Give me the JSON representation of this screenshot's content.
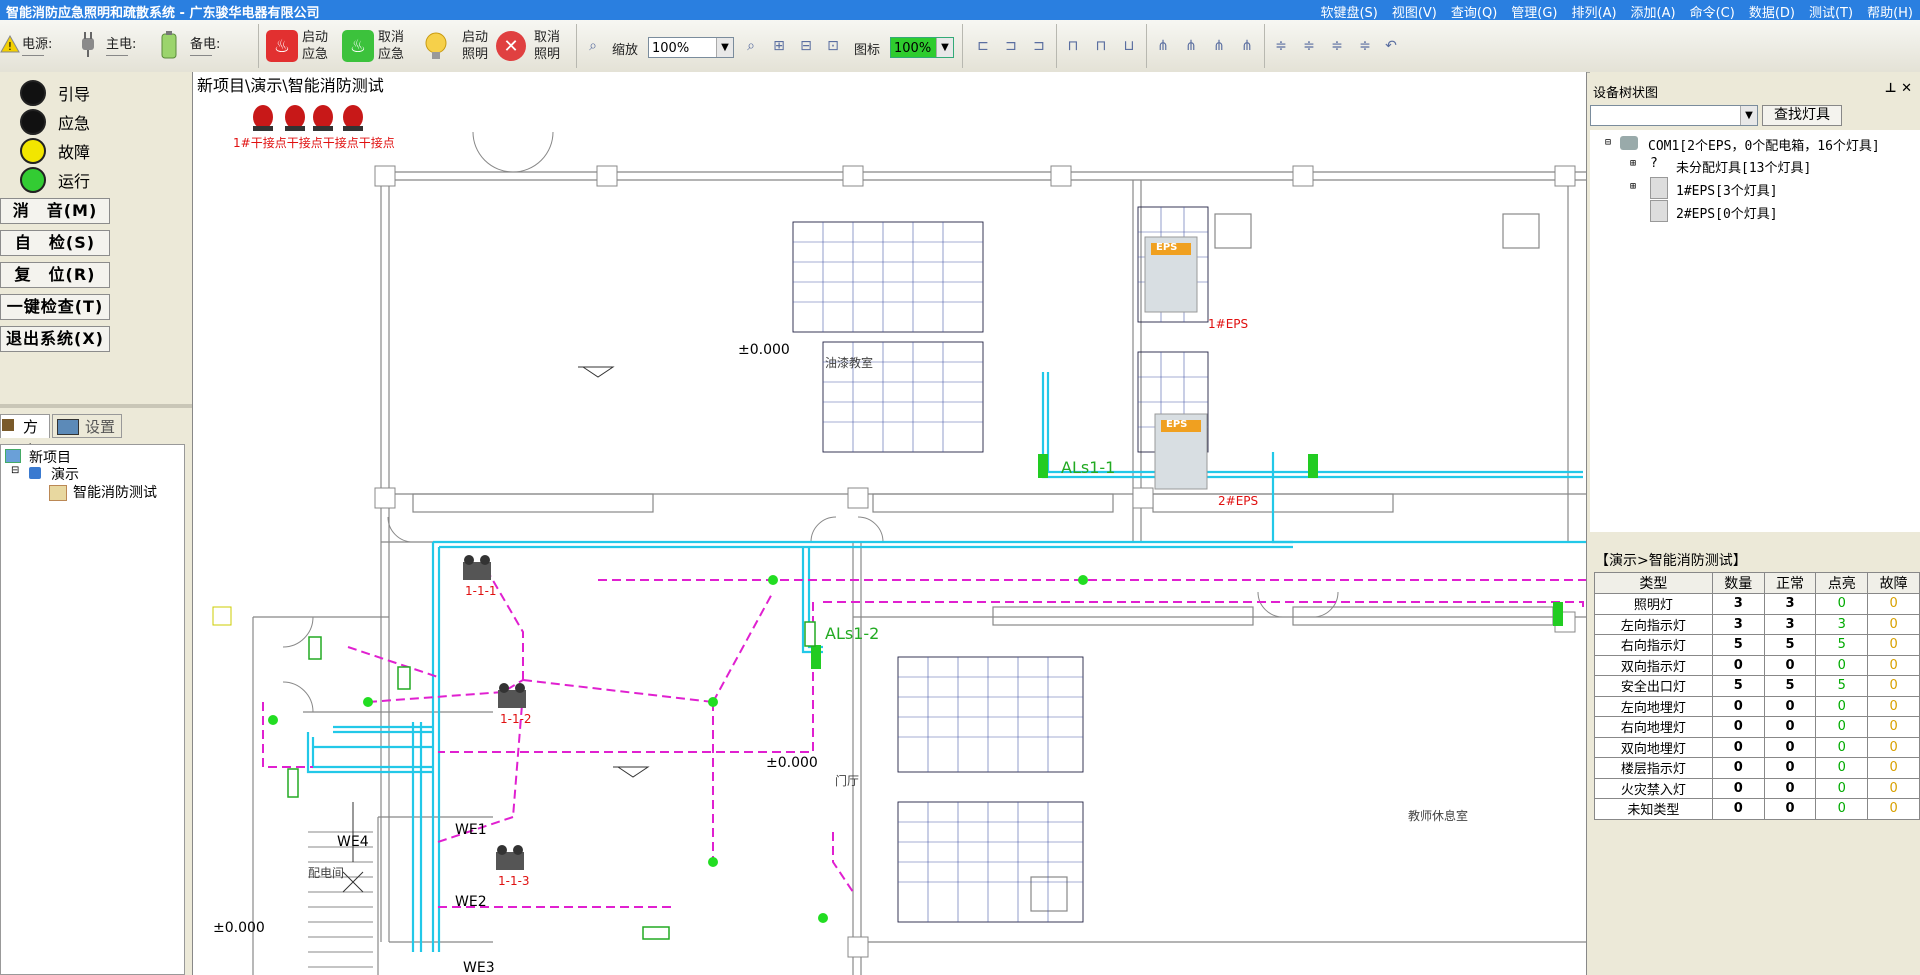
{
  "window": {
    "title": "智能消防应急照明和疏散系统 - 广东骏华电器有限公司"
  },
  "menu": [
    "软键盘(S)",
    "视图(V)",
    "查询(Q)",
    "管理(G)",
    "排列(A)",
    "添加(A)",
    "命令(C)",
    "数据(D)",
    "测试(T)",
    "帮助(H)"
  ],
  "toolbar": {
    "power_label": "电源:",
    "main_label": "主电:",
    "backup_label": "备电:",
    "start_emergency": "启动应急",
    "cancel_emergency": "取消应急",
    "start_lighting": "启动照明",
    "cancel_lighting": "取消照明",
    "zoom_label": "缩放",
    "zoom_value": "100%",
    "icon_label": "图标",
    "icon_value": "100%"
  },
  "status_indicators": [
    {
      "label": "引导",
      "color": "#111111"
    },
    {
      "label": "应急",
      "color": "#111111"
    },
    {
      "label": "故障",
      "color": "#f2e600"
    },
    {
      "label": "运行",
      "color": "#33cc33"
    }
  ],
  "left_buttons": [
    "消　音(M)",
    "自　检(S)",
    "复　位(R)",
    "一键检查(T)",
    "退出系统(X)"
  ],
  "left_tabs": [
    "方案",
    "设置"
  ],
  "project_tree": [
    "新项目",
    "演示",
    "智能消防测试"
  ],
  "canvas": {
    "path_label": "新项目\\演示\\智能消防测试",
    "dry_contact_label": "1#干接点干接点干接点干接点",
    "elevation_1": "±0.000",
    "elevation_2": "±0.000",
    "elevation_3": "±0.000",
    "room_1": "油漆教室",
    "room_2": "门厅",
    "room_3": "教师休息室",
    "room_4": "配电间",
    "eps1_label": "1#EPS",
    "eps2_label": "2#EPS",
    "eps_badge": "EPS",
    "als1": "ALs1-1",
    "als2": "ALs1-2",
    "fixture_1": "1-1-1",
    "fixture_2": "1-1-2",
    "fixture_3": "1-1-3",
    "we1": "WE1",
    "we2": "WE2",
    "we3": "WE3",
    "we4": "WE4"
  },
  "device_tree": {
    "title": "设备树状图",
    "find_button": "查找灯具",
    "root": "COM1[2个EPS，0个配电箱，16个灯具]",
    "unassigned": "未分配灯具[13个灯具]",
    "eps1": "1#EPS[3个灯具]",
    "eps2": "2#EPS[0个灯具]"
  },
  "stats": {
    "crumb": "【演示>智能消防测试】",
    "headers": [
      "类型",
      "数量",
      "正常",
      "点亮",
      "故障"
    ],
    "rows": [
      [
        "照明灯",
        "3",
        "3",
        "0",
        "0"
      ],
      [
        "左向指示灯",
        "3",
        "3",
        "3",
        "0"
      ],
      [
        "右向指示灯",
        "5",
        "5",
        "5",
        "0"
      ],
      [
        "双向指示灯",
        "0",
        "0",
        "0",
        "0"
      ],
      [
        "安全出口灯",
        "5",
        "5",
        "5",
        "0"
      ],
      [
        "左向地埋灯",
        "0",
        "0",
        "0",
        "0"
      ],
      [
        "右向地埋灯",
        "0",
        "0",
        "0",
        "0"
      ],
      [
        "双向地埋灯",
        "0",
        "0",
        "0",
        "0"
      ],
      [
        "楼层指示灯",
        "0",
        "0",
        "0",
        "0"
      ],
      [
        "火灾禁入灯",
        "0",
        "0",
        "0",
        "0"
      ],
      [
        "未知类型",
        "0",
        "0",
        "0",
        "0"
      ]
    ]
  }
}
